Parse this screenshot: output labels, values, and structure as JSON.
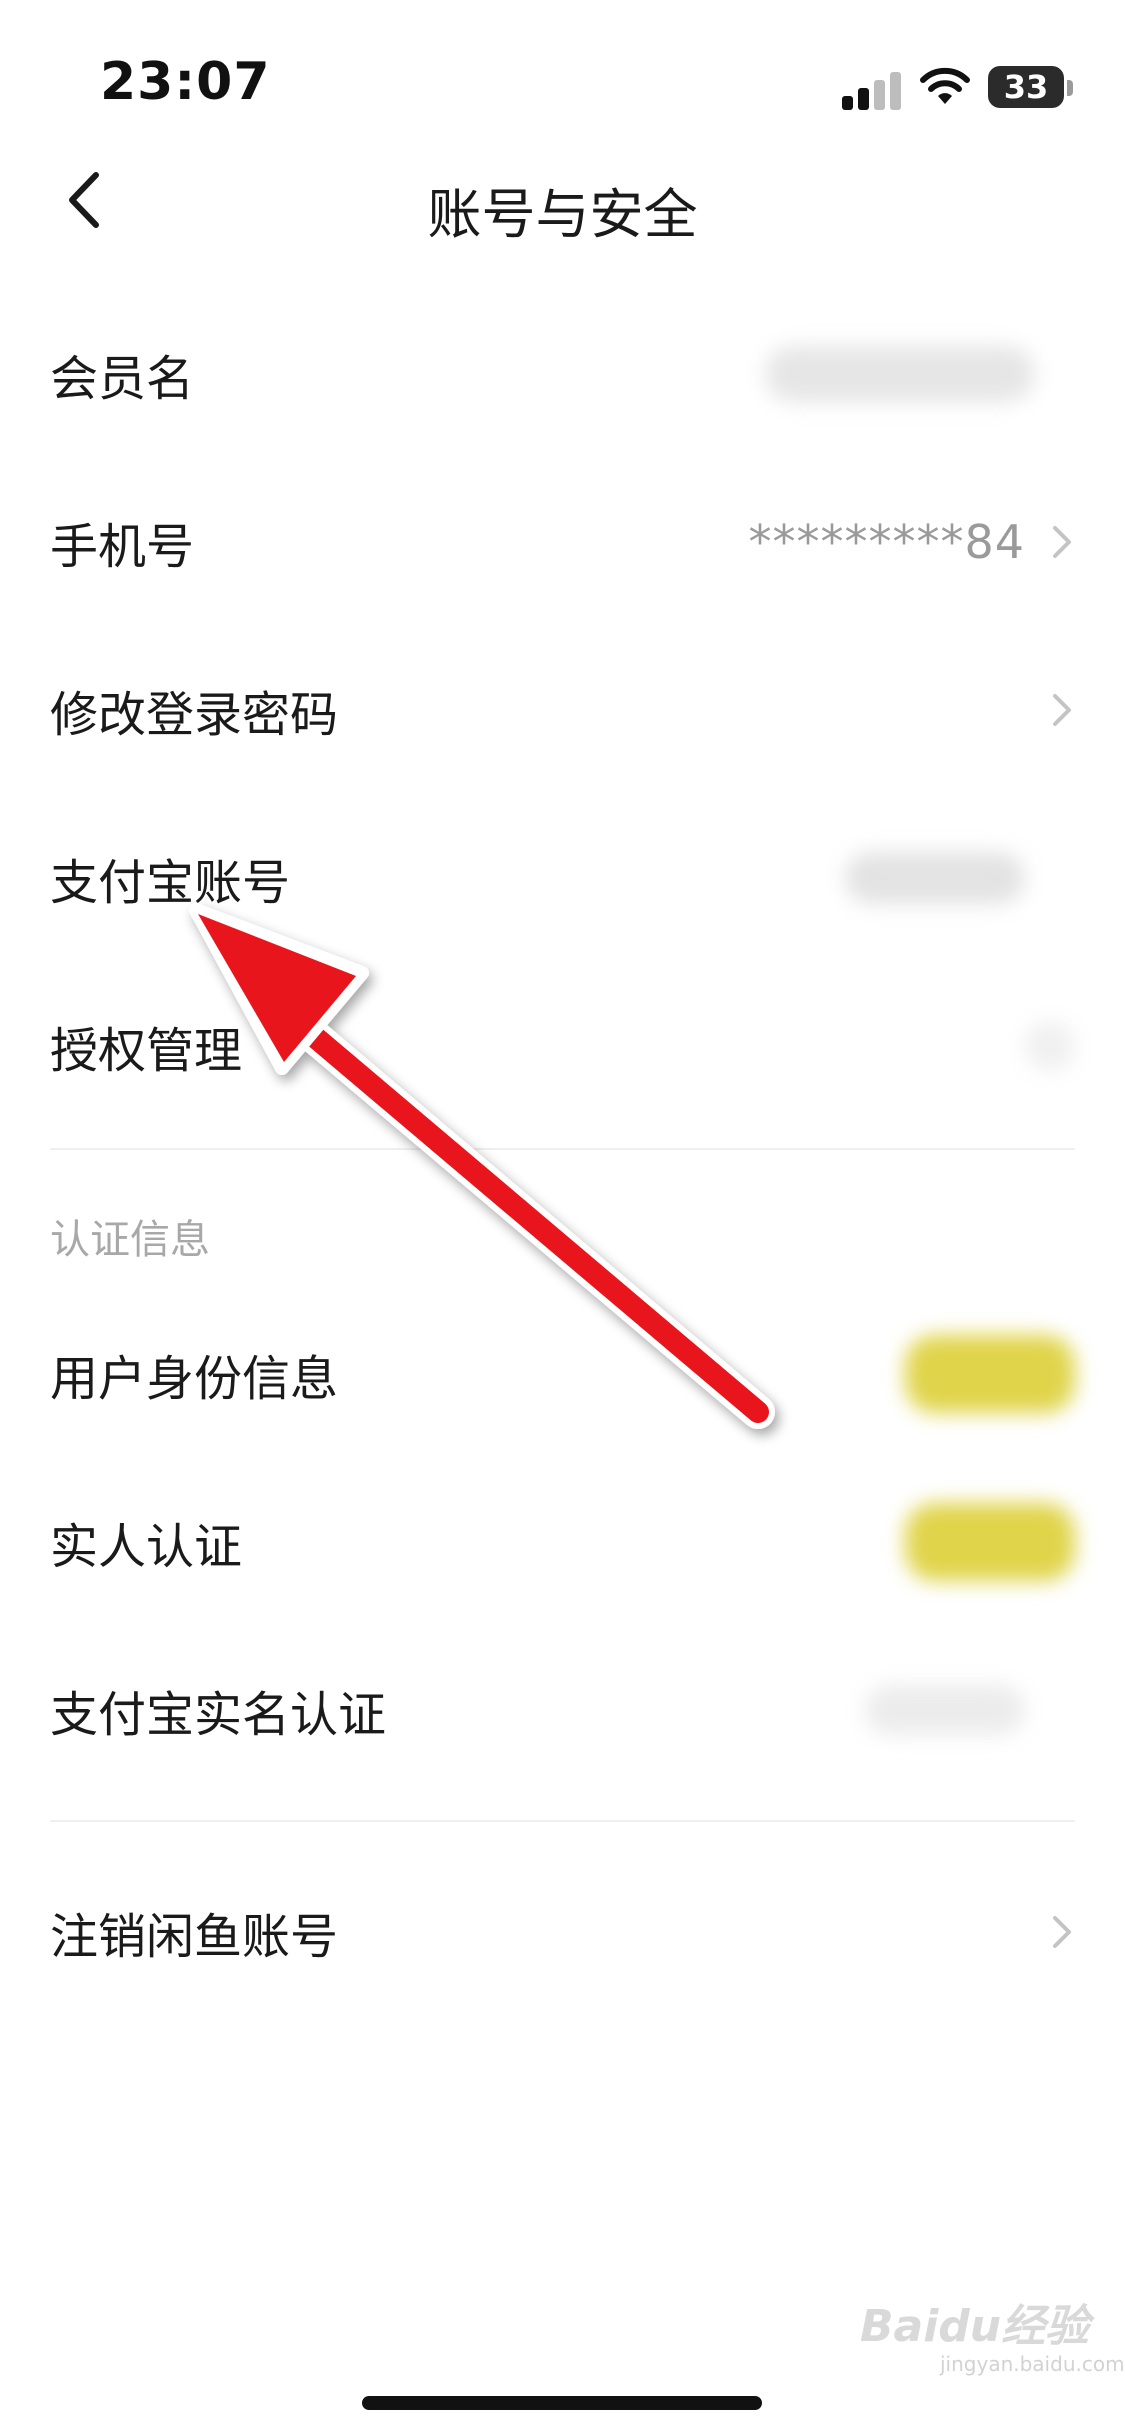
{
  "status_bar": {
    "time": "23:07",
    "battery": "33",
    "icons": [
      "signal-icon",
      "wifi-icon",
      "battery-icon"
    ]
  },
  "nav": {
    "title": "账号与安全",
    "back_icon": "chevron-left-icon"
  },
  "account": {
    "member_name": {
      "label": "会员名",
      "value_hidden": true
    },
    "phone": {
      "label": "手机号",
      "value": "*********84"
    },
    "password": {
      "label": "修改登录密码"
    },
    "alipay_account": {
      "label": "支付宝账号",
      "value_hidden": true
    },
    "authorization": {
      "label": "授权管理"
    }
  },
  "verification": {
    "section_title": "认证信息",
    "identity": {
      "label": "用户身份信息",
      "value_hidden": true
    },
    "real_person": {
      "label": "实人认证",
      "value_hidden": true
    },
    "alipay_realname": {
      "label": "支付宝实名认证",
      "value_hidden": true
    }
  },
  "close_account": {
    "label": "注销闲鱼账号"
  },
  "watermark": {
    "brand": "Baidu经验",
    "url": "jingyan.baidu.com"
  },
  "colors": {
    "arrow": "#e8141c",
    "blurred_badge": "#e0d44a"
  }
}
